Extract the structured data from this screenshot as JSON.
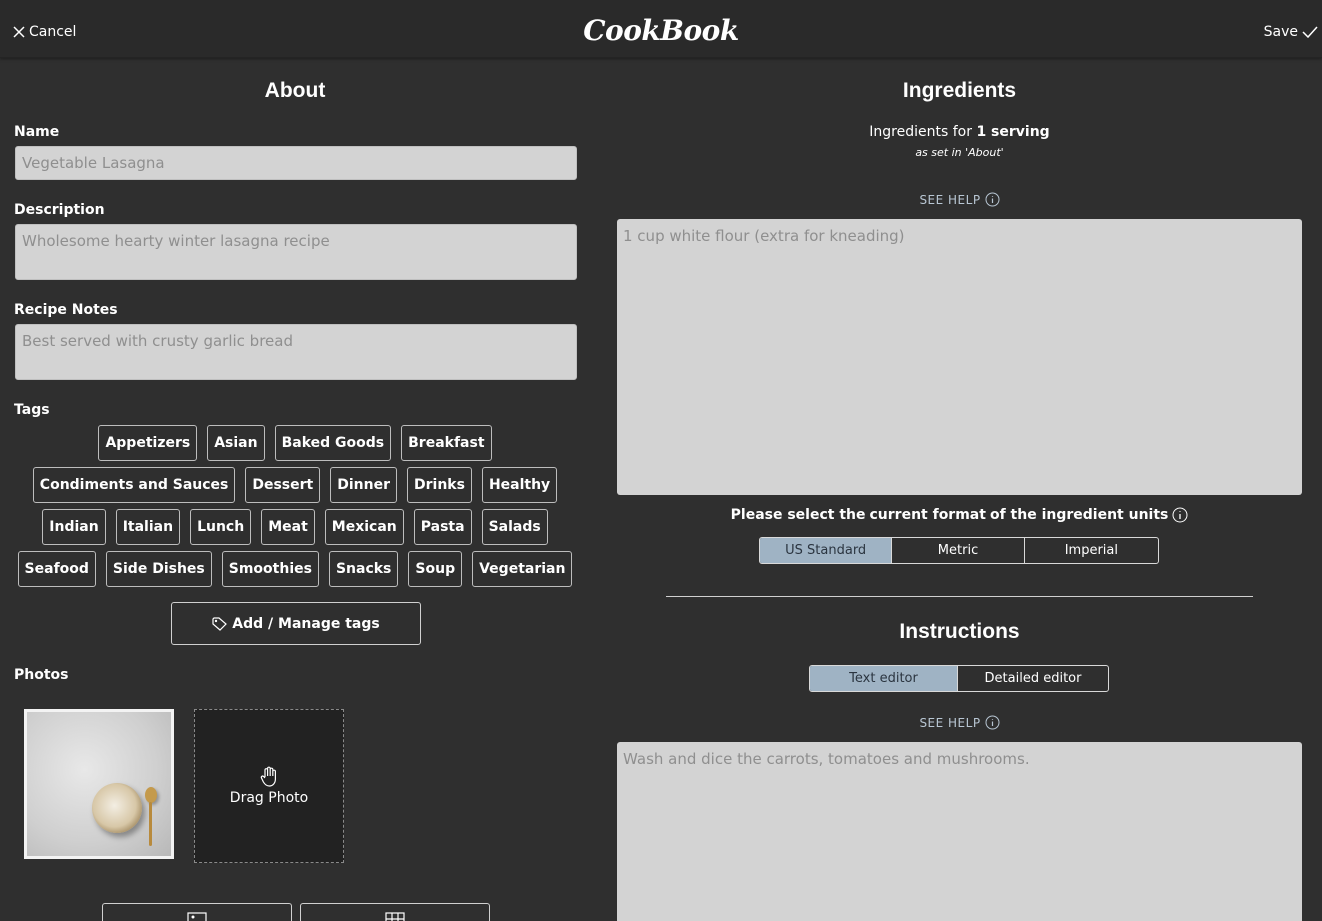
{
  "header": {
    "cancel_label": "Cancel",
    "logo_text": "CookBook",
    "save_label": "Save"
  },
  "about": {
    "heading": "About",
    "name_label": "Name",
    "name_placeholder": "Vegetable Lasagna",
    "description_label": "Description",
    "description_placeholder": "Wholesome hearty winter lasagna recipe",
    "notes_label": "Recipe Notes",
    "notes_placeholder": "Best served with crusty garlic bread",
    "tags_label": "Tags",
    "tags": [
      "Appetizers",
      "Asian",
      "Baked Goods",
      "Breakfast",
      "Condiments and Sauces",
      "Dessert",
      "Dinner",
      "Drinks",
      "Healthy",
      "Indian",
      "Italian",
      "Lunch",
      "Meat",
      "Mexican",
      "Pasta",
      "Salads",
      "Seafood",
      "Side Dishes",
      "Smoothies",
      "Snacks",
      "Soup",
      "Vegetarian"
    ],
    "manage_tags_label": "Add / Manage tags",
    "photos_label": "Photos",
    "drag_photo_label": "Drag Photo"
  },
  "ingredients": {
    "heading": "Ingredients",
    "for_prefix": "Ingredients for",
    "servings": "1 serving",
    "note": "as set in 'About'",
    "see_help": "SEE HELP",
    "placeholder": "1 cup white flour (extra for kneading)",
    "format_prefix": "Please select the",
    "format_bold": "current format",
    "format_suffix": "of the ingredient units",
    "formats": [
      "US Standard",
      "Metric",
      "Imperial"
    ],
    "selected_format": "US Standard"
  },
  "instructions": {
    "heading": "Instructions",
    "editors": [
      "Text editor",
      "Detailed editor"
    ],
    "selected_editor": "Text editor",
    "see_help": "SEE HELP",
    "placeholder": "Wash and dice the carrots, tomatoes and mushrooms."
  },
  "colors": {
    "background": "#2f2f2f",
    "field": "#d3d3d3",
    "active_segment": "#9fb3c4",
    "help_text": "#b8c6d3"
  }
}
